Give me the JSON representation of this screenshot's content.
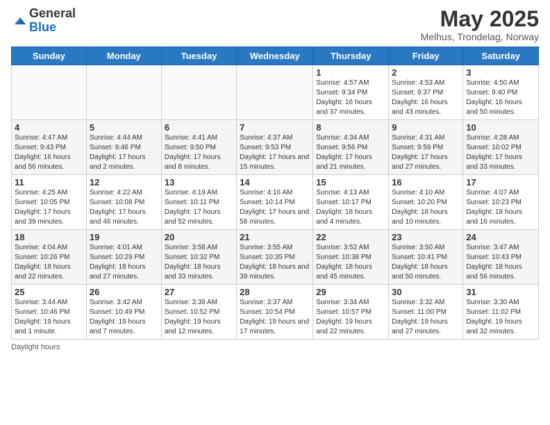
{
  "header": {
    "logo_general": "General",
    "logo_blue": "Blue",
    "month_title": "May 2025",
    "subtitle": "Melhus, Trondelag, Norway"
  },
  "days_of_week": [
    "Sunday",
    "Monday",
    "Tuesday",
    "Wednesday",
    "Thursday",
    "Friday",
    "Saturday"
  ],
  "weeks": [
    [
      {
        "day": "",
        "info": ""
      },
      {
        "day": "",
        "info": ""
      },
      {
        "day": "",
        "info": ""
      },
      {
        "day": "",
        "info": ""
      },
      {
        "day": "1",
        "info": "Sunrise: 4:57 AM\nSunset: 9:34 PM\nDaylight: 16 hours and 37 minutes."
      },
      {
        "day": "2",
        "info": "Sunrise: 4:53 AM\nSunset: 9:37 PM\nDaylight: 16 hours and 43 minutes."
      },
      {
        "day": "3",
        "info": "Sunrise: 4:50 AM\nSunset: 9:40 PM\nDaylight: 16 hours and 50 minutes."
      }
    ],
    [
      {
        "day": "4",
        "info": "Sunrise: 4:47 AM\nSunset: 9:43 PM\nDaylight: 16 hours and 56 minutes."
      },
      {
        "day": "5",
        "info": "Sunrise: 4:44 AM\nSunset: 9:46 PM\nDaylight: 17 hours and 2 minutes."
      },
      {
        "day": "6",
        "info": "Sunrise: 4:41 AM\nSunset: 9:50 PM\nDaylight: 17 hours and 8 minutes."
      },
      {
        "day": "7",
        "info": "Sunrise: 4:37 AM\nSunset: 9:53 PM\nDaylight: 17 hours and 15 minutes."
      },
      {
        "day": "8",
        "info": "Sunrise: 4:34 AM\nSunset: 9:56 PM\nDaylight: 17 hours and 21 minutes."
      },
      {
        "day": "9",
        "info": "Sunrise: 4:31 AM\nSunset: 9:59 PM\nDaylight: 17 hours and 27 minutes."
      },
      {
        "day": "10",
        "info": "Sunrise: 4:28 AM\nSunset: 10:02 PM\nDaylight: 17 hours and 33 minutes."
      }
    ],
    [
      {
        "day": "11",
        "info": "Sunrise: 4:25 AM\nSunset: 10:05 PM\nDaylight: 17 hours and 39 minutes."
      },
      {
        "day": "12",
        "info": "Sunrise: 4:22 AM\nSunset: 10:08 PM\nDaylight: 17 hours and 46 minutes."
      },
      {
        "day": "13",
        "info": "Sunrise: 4:19 AM\nSunset: 10:11 PM\nDaylight: 17 hours and 52 minutes."
      },
      {
        "day": "14",
        "info": "Sunrise: 4:16 AM\nSunset: 10:14 PM\nDaylight: 17 hours and 58 minutes."
      },
      {
        "day": "15",
        "info": "Sunrise: 4:13 AM\nSunset: 10:17 PM\nDaylight: 18 hours and 4 minutes."
      },
      {
        "day": "16",
        "info": "Sunrise: 4:10 AM\nSunset: 10:20 PM\nDaylight: 18 hours and 10 minutes."
      },
      {
        "day": "17",
        "info": "Sunrise: 4:07 AM\nSunset: 10:23 PM\nDaylight: 18 hours and 16 minutes."
      }
    ],
    [
      {
        "day": "18",
        "info": "Sunrise: 4:04 AM\nSunset: 10:26 PM\nDaylight: 18 hours and 22 minutes."
      },
      {
        "day": "19",
        "info": "Sunrise: 4:01 AM\nSunset: 10:29 PM\nDaylight: 18 hours and 27 minutes."
      },
      {
        "day": "20",
        "info": "Sunrise: 3:58 AM\nSunset: 10:32 PM\nDaylight: 18 hours and 33 minutes."
      },
      {
        "day": "21",
        "info": "Sunrise: 3:55 AM\nSunset: 10:35 PM\nDaylight: 18 hours and 39 minutes."
      },
      {
        "day": "22",
        "info": "Sunrise: 3:52 AM\nSunset: 10:38 PM\nDaylight: 18 hours and 45 minutes."
      },
      {
        "day": "23",
        "info": "Sunrise: 3:50 AM\nSunset: 10:41 PM\nDaylight: 18 hours and 50 minutes."
      },
      {
        "day": "24",
        "info": "Sunrise: 3:47 AM\nSunset: 10:43 PM\nDaylight: 18 hours and 56 minutes."
      }
    ],
    [
      {
        "day": "25",
        "info": "Sunrise: 3:44 AM\nSunset: 10:46 PM\nDaylight: 19 hours and 1 minute."
      },
      {
        "day": "26",
        "info": "Sunrise: 3:42 AM\nSunset: 10:49 PM\nDaylight: 19 hours and 7 minutes."
      },
      {
        "day": "27",
        "info": "Sunrise: 3:39 AM\nSunset: 10:52 PM\nDaylight: 19 hours and 12 minutes."
      },
      {
        "day": "28",
        "info": "Sunrise: 3:37 AM\nSunset: 10:54 PM\nDaylight: 19 hours and 17 minutes."
      },
      {
        "day": "29",
        "info": "Sunrise: 3:34 AM\nSunset: 10:57 PM\nDaylight: 19 hours and 22 minutes."
      },
      {
        "day": "30",
        "info": "Sunrise: 3:32 AM\nSunset: 11:00 PM\nDaylight: 19 hours and 27 minutes."
      },
      {
        "day": "31",
        "info": "Sunrise: 3:30 AM\nSunset: 11:02 PM\nDaylight: 19 hours and 32 minutes."
      }
    ]
  ],
  "footer": {
    "daylight_label": "Daylight hours"
  }
}
